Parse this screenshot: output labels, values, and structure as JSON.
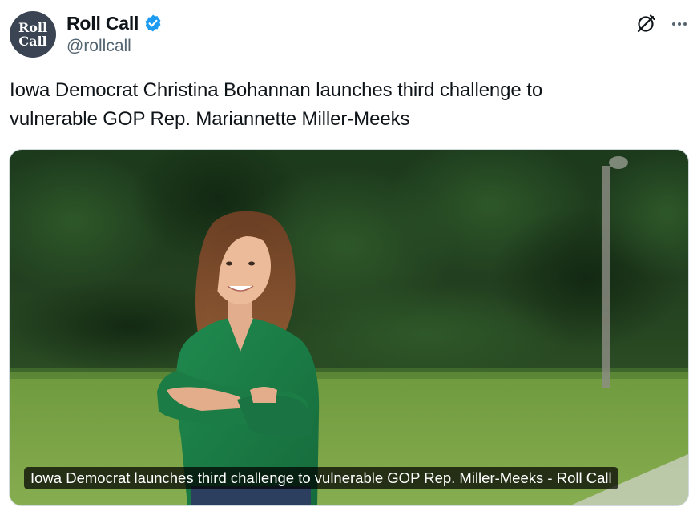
{
  "author": {
    "display_name": "Roll Call",
    "handle": "@rollcall",
    "avatar_line1": "Roll",
    "avatar_line2": "Call",
    "verified": true,
    "verified_color": "#1d9bf0"
  },
  "header_icons": {
    "grok": "grok-icon",
    "more": "more-options-icon"
  },
  "tweet": {
    "line1": "Iowa Democrat Christina Bohannan launches third challenge to",
    "line2": "vulnerable GOP Rep. Mariannette Miller-Meeks"
  },
  "card": {
    "title": "Iowa Democrat launches third challenge to vulnerable GOP Rep. Miller-Meeks - Roll Call",
    "image_subject": "woman in green blouse with arms crossed standing on grass in front of trees"
  }
}
